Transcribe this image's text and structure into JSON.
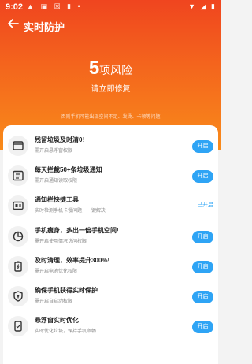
{
  "status_bar": {
    "time": "9:02",
    "icons": [
      "alert-icon",
      "image-icon",
      "close-box-icon",
      "sim-icon",
      "dot-icon"
    ]
  },
  "header": {
    "title": "实时防护"
  },
  "risk": {
    "count": "5",
    "label": "项风险",
    "fix_text": "请立即修复",
    "hint": "否则手机可能出现空间不足、发烫、卡顿等问题"
  },
  "items": [
    {
      "title": "残留垃圾及时清0!",
      "desc": "需开启悬浮窗权限",
      "action": "开启",
      "enabled": false,
      "icon": "window-icon"
    },
    {
      "title": "每天拦截50+条垃圾通知",
      "desc": "需开启通知读取权限",
      "action": "开启",
      "enabled": false,
      "icon": "notification-list-icon"
    },
    {
      "title": "通知栏快捷工具",
      "desc": "实时检测手机卡慢问题，一键解决",
      "action": "已开启",
      "enabled": true,
      "icon": "toolbar-icon"
    },
    {
      "title": "手机瘦身，多出一倍手机空间!",
      "desc": "需开启使用情况访问权限",
      "action": "开启",
      "enabled": false,
      "icon": "pie-chart-icon"
    },
    {
      "title": "及时清理，效率提升300%!",
      "desc": "需开启电池优化权限",
      "action": "开启",
      "enabled": false,
      "icon": "battery-icon"
    },
    {
      "title": "确保手机获得实时保护",
      "desc": "需开启自启动权限",
      "action": "开启",
      "enabled": false,
      "icon": "shield-icon"
    },
    {
      "title": "悬浮窗实时优化",
      "desc": "实时优化垃圾，保持手机顺畅",
      "action": "开启",
      "enabled": false,
      "icon": "phone-optimize-icon"
    }
  ]
}
